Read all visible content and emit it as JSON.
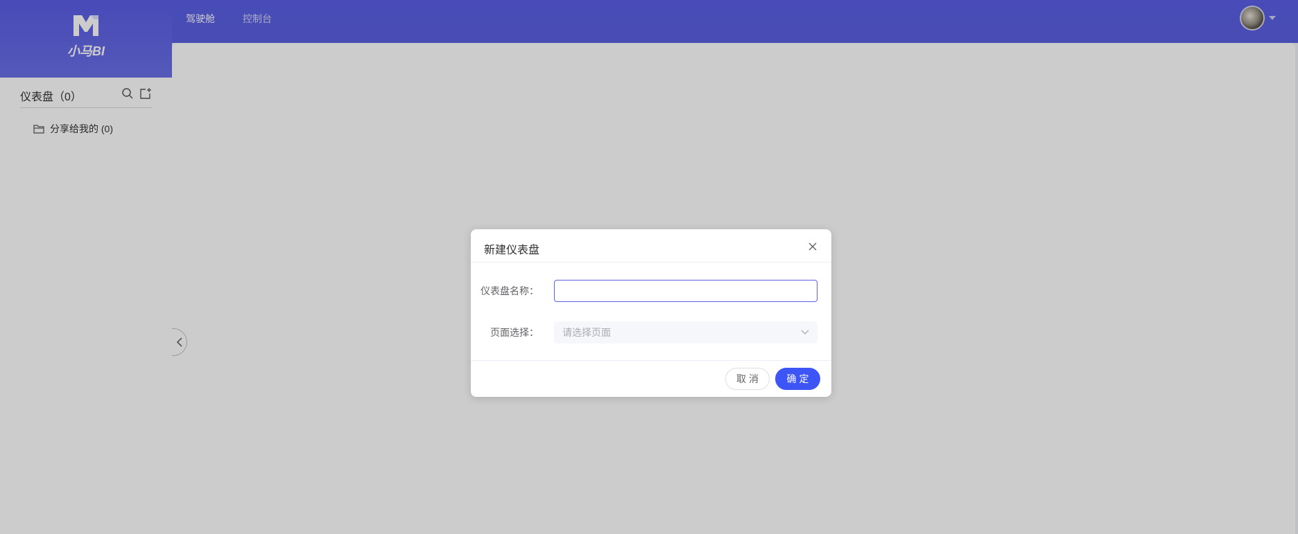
{
  "brand": {
    "name": "小马BI",
    "logo_icon": "horse-m-logo"
  },
  "nav": {
    "items": [
      {
        "label": "驾驶舱",
        "active": true
      },
      {
        "label": "控制台",
        "active": false
      }
    ]
  },
  "user": {
    "avatar_icon": "user-avatar"
  },
  "sidebar": {
    "title": "仪表盘（0）",
    "tools": [
      "search-icon",
      "add-dashboard-icon"
    ],
    "folders": [
      {
        "label": "分享给我的 (0)",
        "icon": "folder-icon"
      }
    ]
  },
  "dialog": {
    "title": "新建仪表盘",
    "name_label": "仪表盘名称：",
    "name_value": "",
    "page_label": "页面选择：",
    "page_placeholder": "请选择页面",
    "cancel_label": "取消",
    "ok_label": "确定"
  },
  "colors": {
    "header": "#5a5ee6",
    "primary_button": "#3d55f5",
    "input_focus_border": "#5b62e6"
  }
}
